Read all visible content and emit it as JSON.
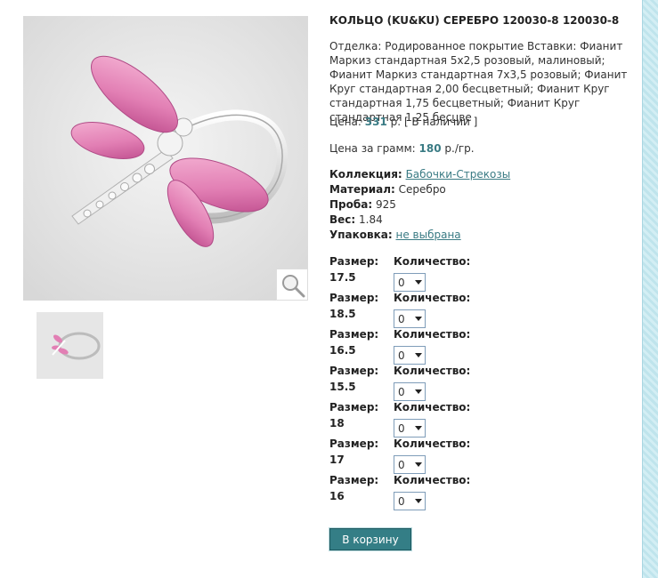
{
  "product": {
    "title": "КОЛЬЦО (KU&KU) СЕРЕБРО 120030-8 120030-8",
    "description": "Отделка: Родированное покрытие Вставки: Фианит Маркиз стандартная 5x2,5 розовый, малиновый; Фианит Маркиз стандартная 7x3,5 розовый; Фианит Круг стандартная 2,00 бесцветный; Фианит Круг стандартная 1,75 бесцветный; Фианит Круг стандартная 1,25 бесцве",
    "price_label": "Цена:",
    "price_value": "331",
    "price_unit": "р.",
    "availability": "[ В наличии ]",
    "gram_price_label": "Цена за грамм:",
    "gram_price_value": "180",
    "gram_price_unit": "р./гр."
  },
  "attributes": {
    "collection_label": "Коллекция:",
    "collection_value": "Бабочки-Стрекозы",
    "material_label": "Материал:",
    "material_value": "Серебро",
    "assay_label": "Проба:",
    "assay_value": "925",
    "weight_label": "Вес:",
    "weight_value": "1.84",
    "packaging_label": "Упаковка:",
    "packaging_value": "не выбрана"
  },
  "size_label": "Размер:",
  "qty_label": "Количество:",
  "sizes": [
    {
      "size": "17.5",
      "qty": "0"
    },
    {
      "size": "18.5",
      "qty": "0"
    },
    {
      "size": "16.5",
      "qty": "0"
    },
    {
      "size": "15.5",
      "qty": "0"
    },
    {
      "size": "18",
      "qty": "0"
    },
    {
      "size": "17",
      "qty": "0"
    },
    {
      "size": "16",
      "qty": "0"
    }
  ],
  "cart_button": "В корзину",
  "icons": {
    "zoom": "magnifier-icon",
    "select_arrow": "chevron-down-icon"
  },
  "colors": {
    "accent": "#347e86",
    "link": "#3a7b84",
    "stone_pink": "#e07bb0"
  }
}
